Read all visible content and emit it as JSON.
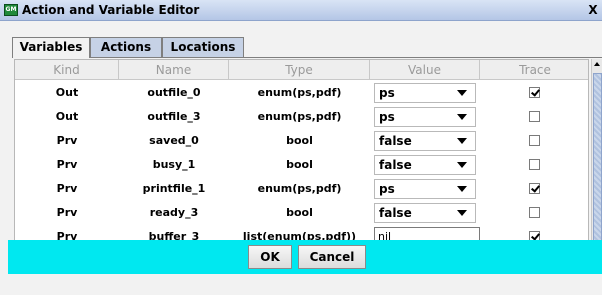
{
  "window": {
    "icon_label": "GM",
    "title": "Action and Variable Editor",
    "close_label": "X"
  },
  "tabs": [
    {
      "label": "Variables",
      "active": true
    },
    {
      "label": "Actions",
      "active": false
    },
    {
      "label": "Locations",
      "active": false
    }
  ],
  "table": {
    "columns": [
      "Kind",
      "Name",
      "Type",
      "Value",
      "Trace"
    ],
    "rows": [
      {
        "kind": "Out",
        "name": "outfile_0",
        "type": "enum(ps,pdf)",
        "value": "ps",
        "editor": "dropdown",
        "trace": true
      },
      {
        "kind": "Out",
        "name": "outfile_3",
        "type": "enum(ps,pdf)",
        "value": "ps",
        "editor": "dropdown",
        "trace": false
      },
      {
        "kind": "Prv",
        "name": "saved_0",
        "type": "bool",
        "value": "false",
        "editor": "dropdown",
        "trace": false
      },
      {
        "kind": "Prv",
        "name": "busy_1",
        "type": "bool",
        "value": "false",
        "editor": "dropdown",
        "trace": false
      },
      {
        "kind": "Prv",
        "name": "printfile_1",
        "type": "enum(ps,pdf)",
        "value": "ps",
        "editor": "dropdown",
        "trace": true
      },
      {
        "kind": "Prv",
        "name": "ready_3",
        "type": "bool",
        "value": "false",
        "editor": "dropdown",
        "trace": false
      },
      {
        "kind": "Prv",
        "name": "buffer_3",
        "type": "list(enum(ps,pdf))",
        "value": "nil",
        "editor": "text",
        "trace": true
      }
    ]
  },
  "buttons": {
    "ok": "OK",
    "cancel": "Cancel"
  },
  "colors": {
    "bottom_bar": "#00e8f0",
    "tab_inactive": "#c6d2e6"
  }
}
